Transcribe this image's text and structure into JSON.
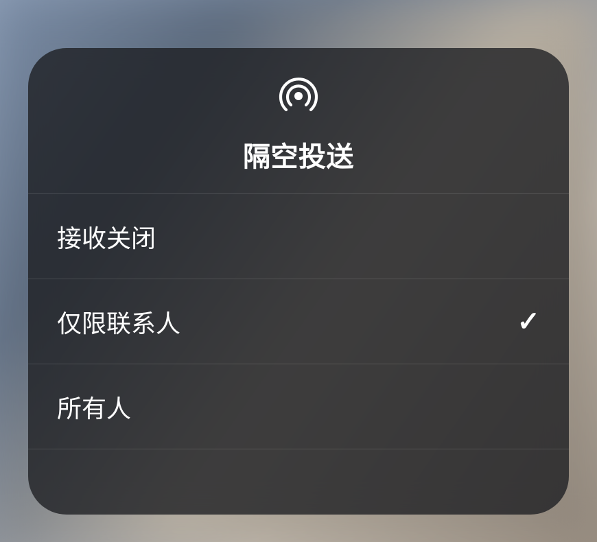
{
  "header": {
    "title": "隔空投送"
  },
  "options": {
    "off": {
      "label": "接收关闭",
      "selected": false
    },
    "contacts": {
      "label": "仅限联系人",
      "selected": true
    },
    "everyone": {
      "label": "所有人",
      "selected": false
    }
  },
  "checkmark_glyph": "✓"
}
